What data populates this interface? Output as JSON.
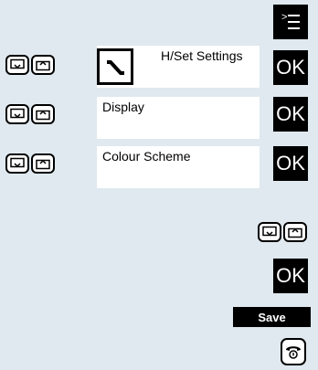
{
  "steps": [
    {
      "label": "H/Set Settings",
      "ok": "OK"
    },
    {
      "label": "Display",
      "ok": "OK"
    },
    {
      "label": "Colour Scheme",
      "ok": "OK"
    }
  ],
  "confirm": {
    "ok": "OK"
  },
  "save_label": "Save",
  "icons": {
    "menu": "menu-key-icon",
    "nav_down": "nav-down-icon",
    "nav_up": "nav-up-icon",
    "tools": "wrench-icon",
    "end": "end-call-icon"
  },
  "colors": {
    "background": "#dfe9ef",
    "key": "#000000",
    "box": "#ffffff"
  }
}
